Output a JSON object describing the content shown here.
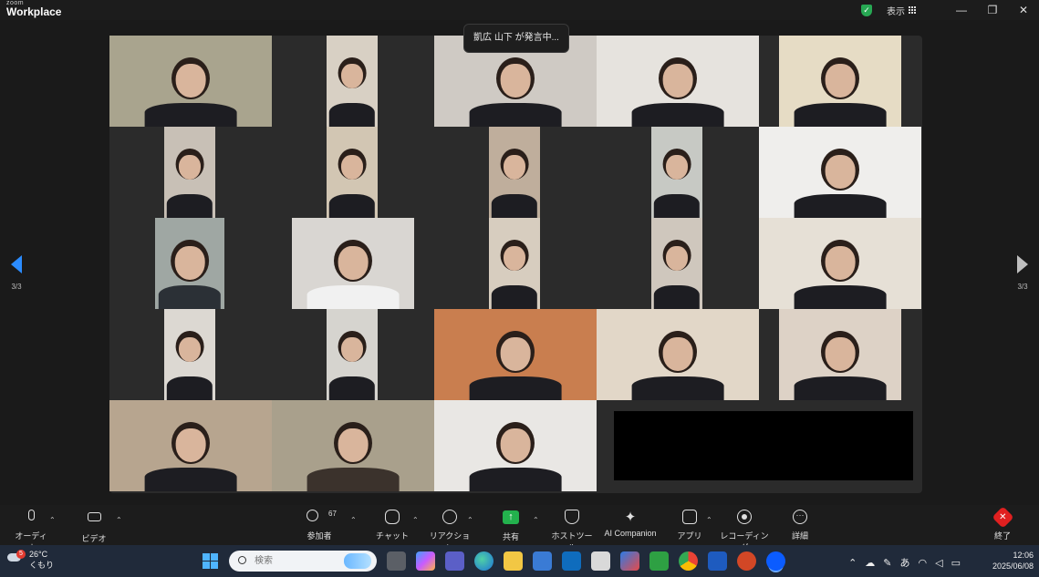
{
  "app": {
    "brand_small": "zoom",
    "brand_big": "Workplace",
    "view_label": "表示",
    "window_buttons": [
      "—",
      "❐",
      "✕"
    ]
  },
  "meeting": {
    "speaking_banner": "凱広 山下 が発言中...",
    "page_left": "3/3",
    "page_right": "3/3"
  },
  "toolbar": {
    "audio": "オーディオ",
    "video": "ビデオ",
    "participants": "参加者",
    "participants_count": "67",
    "chat": "チャット",
    "reactions": "リアクション",
    "share": "共有",
    "host_tools": "ホストツール",
    "ai_companion": "AI Companion",
    "apps": "アプリ",
    "recording": "レコーディング",
    "more": "詳細",
    "end": "終了"
  },
  "taskbar": {
    "weather_temp": "26°C",
    "weather_desc": "くもり",
    "weather_badge": "5",
    "search_placeholder": "検索",
    "tray_ime": "あ",
    "time": "12:06",
    "date": "2025/06/08"
  },
  "colors": {
    "accent": "#2b8cff",
    "share": "#23b14d",
    "end": "#e02020",
    "shield": "#27a853"
  },
  "tiles": [
    {
      "bg": "#a9a48e",
      "shirt": "#1d1d22"
    },
    {
      "bg": "#d8d0c4",
      "shirt": "#1d1d22"
    },
    {
      "bg": "#cfcac4",
      "shirt": "#1d1d22"
    },
    {
      "bg": "#e6e3de",
      "shirt": "#1d1d22"
    },
    {
      "bg": "#e6dcc5",
      "shirt": "#1d1d22"
    },
    {
      "bg": "#c8c0b6",
      "shirt": "#1d1d22"
    },
    {
      "bg": "#d2c6b3",
      "shirt": "#1d1d22"
    },
    {
      "bg": "#bfae9c",
      "shirt": "#1d1d22"
    },
    {
      "bg": "#c7c9c4",
      "shirt": "#1d1d22"
    },
    {
      "bg": "#efeeec",
      "shirt": "#1d1d22"
    },
    {
      "bg": "#9fa7a3",
      "shirt": "#2b3036"
    },
    {
      "bg": "#d9d6d2",
      "shirt": "#f1f1f1"
    },
    {
      "bg": "#d7cdbf",
      "shirt": "#1d1d22"
    },
    {
      "bg": "#cfc7bd",
      "shirt": "#1d1d22"
    },
    {
      "bg": "#e6e0d6",
      "shirt": "#1d1d22"
    },
    {
      "bg": "#dcd8d2",
      "shirt": "#1d1d22"
    },
    {
      "bg": "#d6d4cf",
      "shirt": "#1d1d22"
    },
    {
      "bg": "#c97e4f",
      "shirt": "#1d1d22"
    },
    {
      "bg": "#e2d7c8",
      "shirt": "#1d1d22"
    },
    {
      "bg": "#ddd2c6",
      "shirt": "#1d1d22"
    },
    {
      "bg": "#b7a58f",
      "shirt": "#1d1d22"
    },
    {
      "bg": "#a9a08c",
      "shirt": "#3b322c"
    },
    {
      "bg": "#e9e7e4",
      "shirt": "#1d1d22"
    }
  ]
}
